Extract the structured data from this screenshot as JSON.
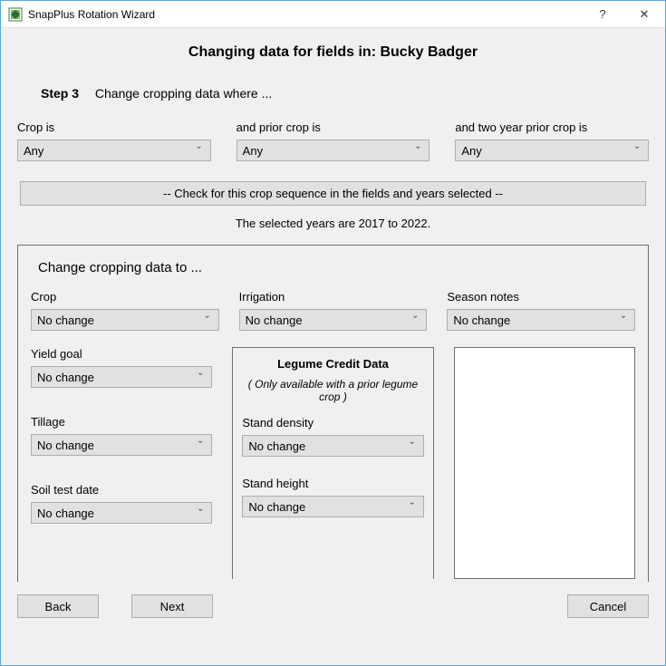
{
  "window": {
    "title": "SnapPlus Rotation Wizard",
    "help_symbol": "?",
    "close_symbol": "✕"
  },
  "header": {
    "page_title": "Changing data for fields in: Bucky Badger",
    "step_label": "Step 3",
    "step_text": "Change cropping data where ..."
  },
  "filters": {
    "crop_label": "Crop is",
    "crop_value": "Any",
    "prior_label": "and prior crop is",
    "prior_value": "Any",
    "two_prior_label": "and two year prior crop is",
    "two_prior_value": "Any"
  },
  "check_banner": "-- Check for this crop sequence in the fields and years selected --",
  "selected_years": "The selected years are 2017 to 2022.",
  "change": {
    "title": "Change cropping data to ...",
    "crop_label": "Crop",
    "crop_value": "No change",
    "irrigation_label": "Irrigation",
    "irrigation_value": "No change",
    "season_notes_label": "Season notes",
    "season_notes_value": "No change",
    "yield_goal_label": "Yield goal",
    "yield_goal_value": "No change",
    "tillage_label": "Tillage",
    "tillage_value": "No change",
    "soil_test_date_label": "Soil test date",
    "soil_test_date_value": "No change"
  },
  "legume": {
    "title": "Legume Credit Data",
    "subtitle": "( Only available with a prior legume crop )",
    "stand_density_label": "Stand density",
    "stand_density_value": "No change",
    "stand_height_label": "Stand height",
    "stand_height_value": "No change"
  },
  "footer": {
    "back_label": "Back",
    "next_label": "Next",
    "cancel_label": "Cancel"
  },
  "glyphs": {
    "chevron_down": "ˇ"
  }
}
